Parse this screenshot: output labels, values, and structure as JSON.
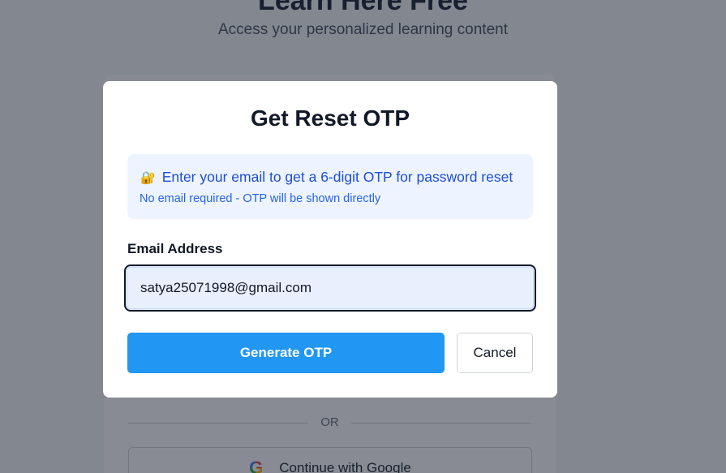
{
  "background": {
    "title": "Learn Here Free",
    "subtitle": "Access your personalized learning content",
    "divider_text": "OR",
    "google_button_label": "Continue with Google",
    "google_icon": "G"
  },
  "modal": {
    "title": "Get Reset OTP",
    "info": {
      "icon": "🔐",
      "icon_name": "lock-key-icon",
      "message": "Enter your email to get a 6-digit OTP for password reset",
      "note": "No email required - OTP will be shown directly"
    },
    "email_label": "Email Address",
    "email_value": "satya25071998@gmail.com",
    "generate_label": "Generate OTP",
    "cancel_label": "Cancel"
  },
  "colors": {
    "primary": "#2196f3",
    "info_bg": "#eef4ff",
    "info_text": "#1d4ed8"
  }
}
